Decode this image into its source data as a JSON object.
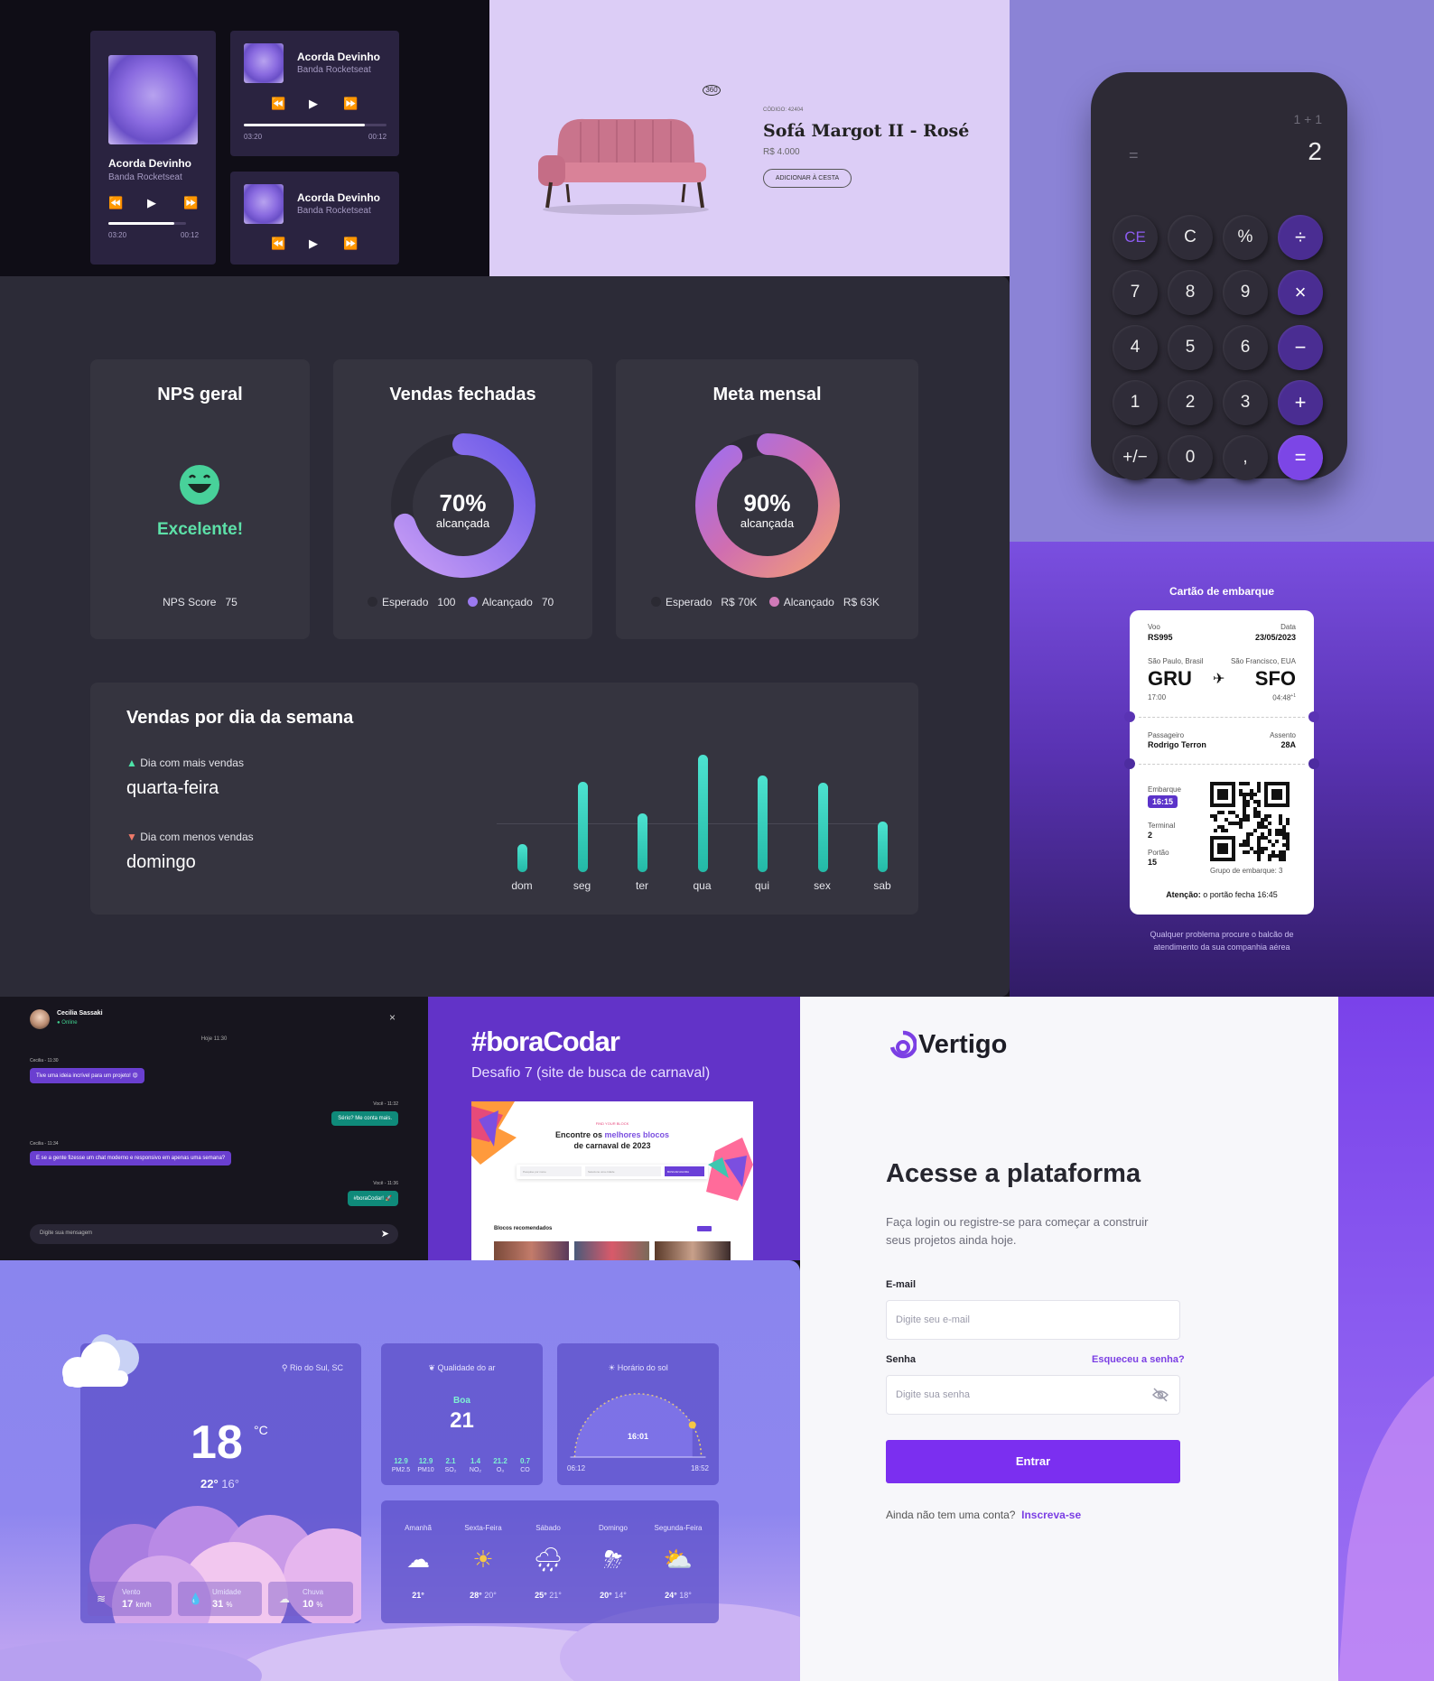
{
  "music": {
    "title": "Acorda Devinho",
    "artist": "Banda Rocketseat",
    "time_current": "03:20",
    "time_total": "00:12",
    "progress": 0.85
  },
  "sofa": {
    "code": "CÓDIGO: 42404",
    "name": "Sofá Margot II - Rosé",
    "price": "R$ 4.000",
    "cart_label": "ADICIONAR À CESTA",
    "badge_360": "360"
  },
  "calculator": {
    "expression": "1 + 1",
    "equals_symbol": "=",
    "result": "2",
    "keys": [
      [
        "CE",
        "C",
        "%",
        "÷"
      ],
      [
        "7",
        "8",
        "9",
        "×"
      ],
      [
        "4",
        "5",
        "6",
        "−"
      ],
      [
        "1",
        "2",
        "3",
        "+"
      ],
      [
        "+/−",
        "0",
        ",",
        "="
      ]
    ]
  },
  "dashboard": {
    "nps": {
      "title": "NPS geral",
      "status": "Excelente!",
      "score_label": "NPS Score",
      "score": "75"
    },
    "vendas": {
      "title": "Vendas fechadas",
      "percent": "70%",
      "sub": "alcançada",
      "expected_label": "Esperado",
      "expected": "100",
      "reached_label": "Alcançado",
      "reached": "70",
      "fraction": 0.7
    },
    "meta": {
      "title": "Meta mensal",
      "percent": "90%",
      "sub": "alcançada",
      "expected_label": "Esperado",
      "expected": "R$ 70K",
      "reached_label": "Alcançado",
      "reached": "R$ 63K",
      "fraction": 0.9
    },
    "weekly": {
      "title": "Vendas por dia da semana",
      "most_label": "Dia com mais vendas",
      "most_day": "quarta-feira",
      "least_label": "Dia com menos vendas",
      "least_day": "domingo"
    }
  },
  "chart_data": {
    "type": "bar",
    "categories": [
      "dom",
      "seg",
      "ter",
      "qua",
      "qui",
      "sex",
      "sab"
    ],
    "values": [
      24,
      77,
      50,
      100,
      82,
      76,
      43
    ],
    "ylim": [
      0,
      100
    ]
  },
  "boarding": {
    "title": "Cartão de embarque",
    "voo_label": "Voo",
    "voo": "RS995",
    "data_label": "Data",
    "data": "23/05/2023",
    "from_city": "São Paulo, Brasil",
    "from": "GRU",
    "from_time": "17:00",
    "to_city": "São Francisco, EUA",
    "to": "SFO",
    "to_time": "04:48",
    "to_time_sup": "+1",
    "pass_label": "Passageiro",
    "pass": "Rodrigo Terron",
    "seat_label": "Assento",
    "seat": "28A",
    "embarque_label": "Embarque",
    "embarque": "16:15",
    "terminal_label": "Terminal",
    "terminal": "2",
    "portao_label": "Portão",
    "portao": "15",
    "group": "Grupo de embarque: 3",
    "attention_bold": "Atenção:",
    "attention": "o portão fecha 16:45",
    "footer": "Qualquer problema procure o balcão de atendimento da sua companhia aérea"
  },
  "chat": {
    "name": "Cecilia Sassaki",
    "status": "Online",
    "day": "Hoje 11:30",
    "messages": [
      {
        "who": "Cecilia - 11:30",
        "text": "Tive uma ideia incrível para um projeto! 😍",
        "side": "left"
      },
      {
        "who": "Você - 11:32",
        "text": "Sério? Me conta mais.",
        "side": "right"
      },
      {
        "who": "Cecilia - 11:34",
        "text": "E se a gente fizesse um chat moderno e responsivo em apenas uma semana?",
        "side": "left"
      },
      {
        "who": "Você - 11:36",
        "text": "#boraCodar! 🚀",
        "side": "right"
      }
    ],
    "placeholder": "Digite sua mensagem"
  },
  "bora": {
    "title": "#boraCodar",
    "subtitle": "Desafio 7 (site de busca de carnaval)",
    "shot_kicker": "FIND YOUR BLOCK",
    "shot_title_a": "Encontre os ",
    "shot_title_highlight": "melhores blocos",
    "shot_title_b": "de carnaval de 2023",
    "shot_search1": "Pesquise por nome",
    "shot_search2": "Selecione uma cidade",
    "shot_button": "BUSCAR AGORA",
    "shot_section": "Blocos recomendados"
  },
  "weather": {
    "location": "Rio do Sul, SC",
    "temp": "18",
    "unit": "°C",
    "max": "22°",
    "min": "16°",
    "wind_label": "Vento",
    "wind": "17",
    "wind_unit": "km/h",
    "hum_label": "Umidade",
    "hum": "31",
    "hum_unit": "%",
    "rain_label": "Chuva",
    "rain": "10",
    "rain_unit": "%",
    "air_title": "Qualidade do ar",
    "air_status": "Boa",
    "air_value": "21",
    "air_items": [
      {
        "v": "12.9",
        "l": "PM2.5"
      },
      {
        "v": "12.9",
        "l": "PM10"
      },
      {
        "v": "2.1",
        "l": "SO₂"
      },
      {
        "v": "1.4",
        "l": "NO₂"
      },
      {
        "v": "21.2",
        "l": "O₃"
      },
      {
        "v": "0.7",
        "l": "CO"
      }
    ],
    "sun_title": "Horário do sol",
    "sun_now": "16:01",
    "sunrise": "06:12",
    "sunset": "18:52",
    "sun_fraction": 0.83,
    "forecast": [
      {
        "day": "Amanhã",
        "max": "21°",
        "min": "",
        "icon": "cloudy-icon"
      },
      {
        "day": "Sexta-Feira",
        "max": "28°",
        "min": "20°",
        "icon": "sunny-icon"
      },
      {
        "day": "Sábado",
        "max": "25°",
        "min": "21°",
        "icon": "rain-icon"
      },
      {
        "day": "Domingo",
        "max": "20°",
        "min": "14°",
        "icon": "storm-icon"
      },
      {
        "day": "Segunda-Feira",
        "max": "24°",
        "min": "18°",
        "icon": "partly-cloudy-icon"
      }
    ]
  },
  "login": {
    "brand": "Vertigo",
    "title": "Acesse a plataforma",
    "desc": "Faça login ou registre-se para começar a construir seus projetos ainda hoje.",
    "email_label": "E-mail",
    "email_placeholder": "Digite seu e-mail",
    "pass_label": "Senha",
    "forgot": "Esqueceu a senha?",
    "pass_placeholder": "Digite sua senha",
    "submit": "Entrar",
    "no_account": "Ainda não tem uma conta?",
    "signup": "Inscreva-se"
  }
}
